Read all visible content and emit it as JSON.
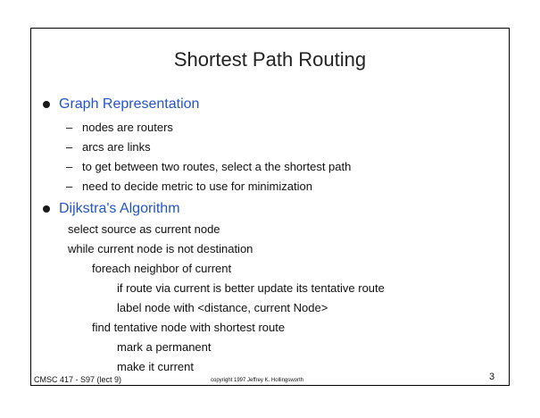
{
  "slide": {
    "title": "Shortest Path Routing",
    "sections": [
      {
        "heading": "Graph Representation",
        "items": [
          "nodes are routers",
          "arcs are links",
          "to get between two routes, select a the shortest path",
          "need to decide metric to use for minimization"
        ]
      },
      {
        "heading": "Dijkstra's Algorithm",
        "pseudocode": [
          "select source as current node",
          "while current node is not destination",
          "foreach neighbor of current",
          "if route via current is better update its tentative route",
          "label node with <distance, current Node>",
          "find tentative node with shortest route",
          "mark a permanent",
          "make it current"
        ]
      }
    ],
    "dash_glyph": "–"
  },
  "footer": {
    "course": "CMSC 417 - S97 (lect 9)",
    "copyright": "copyright 1997 Jeffrey K. Hollingsworth",
    "page": "3"
  }
}
